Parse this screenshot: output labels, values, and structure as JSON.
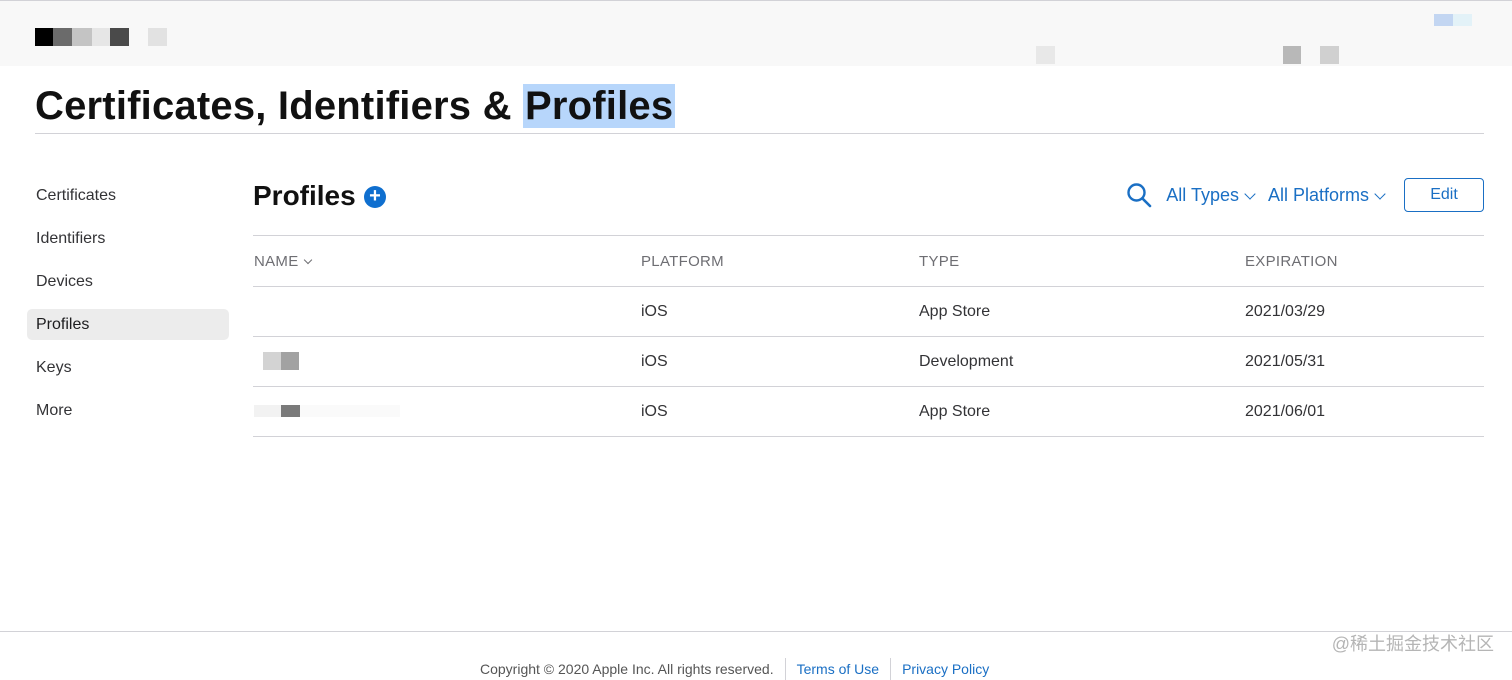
{
  "page": {
    "title_prefix": "Certificates, Identifiers & ",
    "title_highlight": "Profiles"
  },
  "sidebar": {
    "items": [
      {
        "label": "Certificates",
        "active": false
      },
      {
        "label": "Identifiers",
        "active": false
      },
      {
        "label": "Devices",
        "active": false
      },
      {
        "label": "Profiles",
        "active": true
      },
      {
        "label": "Keys",
        "active": false
      },
      {
        "label": "More",
        "active": false
      }
    ]
  },
  "section": {
    "title": "Profiles",
    "add_icon": "plus-circle-icon",
    "search_icon": "search-icon"
  },
  "filters": {
    "types": "All Types",
    "platforms": "All Platforms"
  },
  "toolbar": {
    "edit_label": "Edit"
  },
  "table": {
    "headers": {
      "name": "NAME",
      "platform": "PLATFORM",
      "type": "TYPE",
      "expiration": "EXPIRATION"
    },
    "rows": [
      {
        "name": "",
        "platform": "iOS",
        "type": "App Store",
        "expiration": "2021/03/29"
      },
      {
        "name": "",
        "platform": "iOS",
        "type": "Development",
        "expiration": "2021/05/31"
      },
      {
        "name": "",
        "platform": "iOS",
        "type": "App Store",
        "expiration": "2021/06/01"
      }
    ]
  },
  "footer": {
    "copyright": "Copyright © 2020 Apple Inc. All rights reserved.",
    "terms": "Terms of Use",
    "privacy": "Privacy Policy"
  },
  "watermark": "@稀土掘金技术社区",
  "colors": {
    "accent": "#1a6fc4",
    "highlight": "#b7d6fb",
    "divider": "#d2d2d7"
  }
}
